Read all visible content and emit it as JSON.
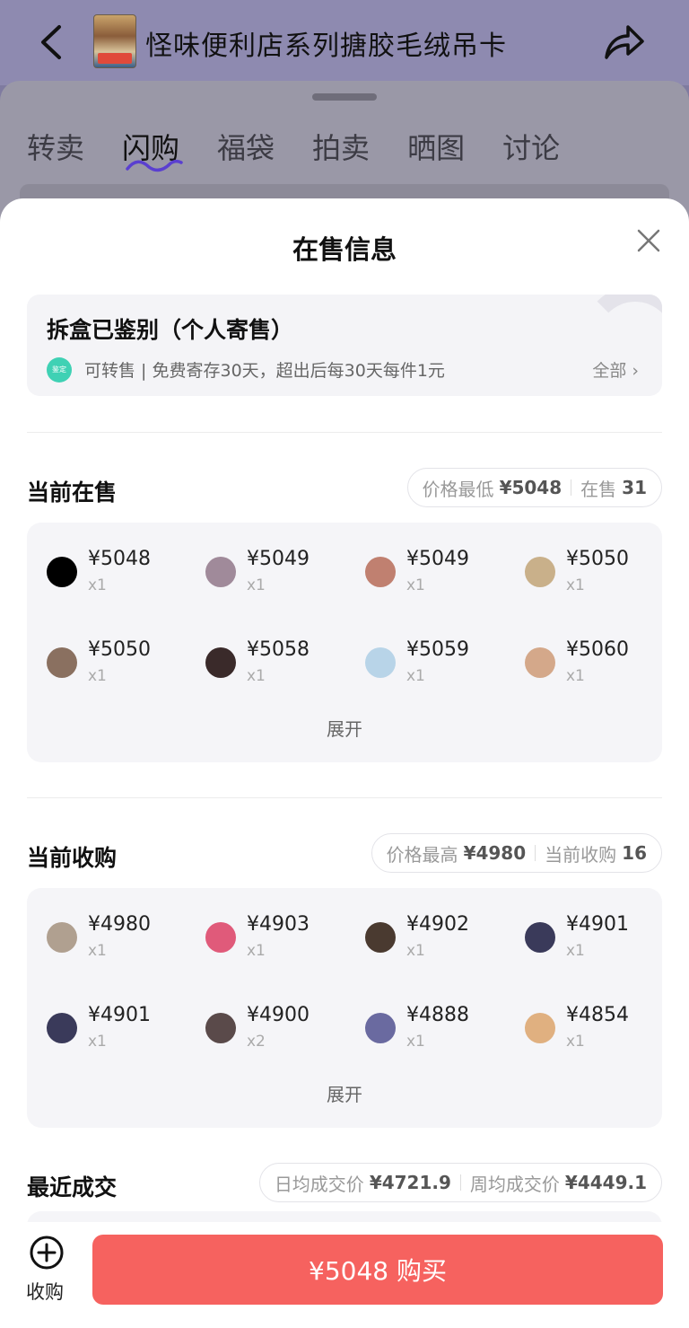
{
  "header": {
    "title": "怪味便利店系列搪胶毛绒吊卡"
  },
  "tabs": [
    {
      "label": "转卖"
    },
    {
      "label": "闪购"
    },
    {
      "label": "福袋"
    },
    {
      "label": "拍卖"
    },
    {
      "label": "晒图"
    },
    {
      "label": "讨论"
    }
  ],
  "sheet": {
    "title": "在售信息",
    "auth": {
      "title": "拆盒已鉴别（个人寄售）",
      "subtitle": "可转售 | 免费寄存30天，超出后每30天每件1元",
      "all_label": "全部 ›",
      "logo_text": "鉴定"
    },
    "selling": {
      "title": "当前在售",
      "stat1_label": "价格最低",
      "stat1_value": "¥5048",
      "stat2_label": "在售",
      "stat2_value": "31",
      "items": [
        {
          "price": "¥5048",
          "qty": "x1",
          "color": "#000000"
        },
        {
          "price": "¥5049",
          "qty": "x1",
          "color": "#a08a9a"
        },
        {
          "price": "¥5049",
          "qty": "x1",
          "color": "#c08070"
        },
        {
          "price": "¥5050",
          "qty": "x1",
          "color": "#c9b08a"
        },
        {
          "price": "¥5050",
          "qty": "x1",
          "color": "#8a7060"
        },
        {
          "price": "¥5058",
          "qty": "x1",
          "color": "#3a2a2a"
        },
        {
          "price": "¥5059",
          "qty": "x1",
          "color": "#b8d4e8"
        },
        {
          "price": "¥5060",
          "qty": "x1",
          "color": "#d4a88a"
        }
      ],
      "expand_label": "展开"
    },
    "buying": {
      "title": "当前收购",
      "stat1_label": "价格最高",
      "stat1_value": "¥4980",
      "stat2_label": "当前收购",
      "stat2_value": "16",
      "items": [
        {
          "price": "¥4980",
          "qty": "x1",
          "color": "#b0a090"
        },
        {
          "price": "¥4903",
          "qty": "x1",
          "color": "#e05a7a"
        },
        {
          "price": "¥4902",
          "qty": "x1",
          "color": "#4a3a30"
        },
        {
          "price": "¥4901",
          "qty": "x1",
          "color": "#3a3a5a"
        },
        {
          "price": "¥4901",
          "qty": "x1",
          "color": "#3a3a5a"
        },
        {
          "price": "¥4900",
          "qty": "x2",
          "color": "#5a4a4a"
        },
        {
          "price": "¥4888",
          "qty": "x1",
          "color": "#6a6aa0"
        },
        {
          "price": "¥4854",
          "qty": "x1",
          "color": "#e0b080"
        }
      ],
      "expand_label": "展开"
    },
    "recent": {
      "title": "最近成交",
      "stat1_label": "日均成交价",
      "stat1_value": "¥4721.9",
      "stat2_label": "周均成交价",
      "stat2_value": "¥4449.1"
    }
  },
  "bottom": {
    "collect_label": "收购",
    "buy_label": "¥5048 购买"
  }
}
